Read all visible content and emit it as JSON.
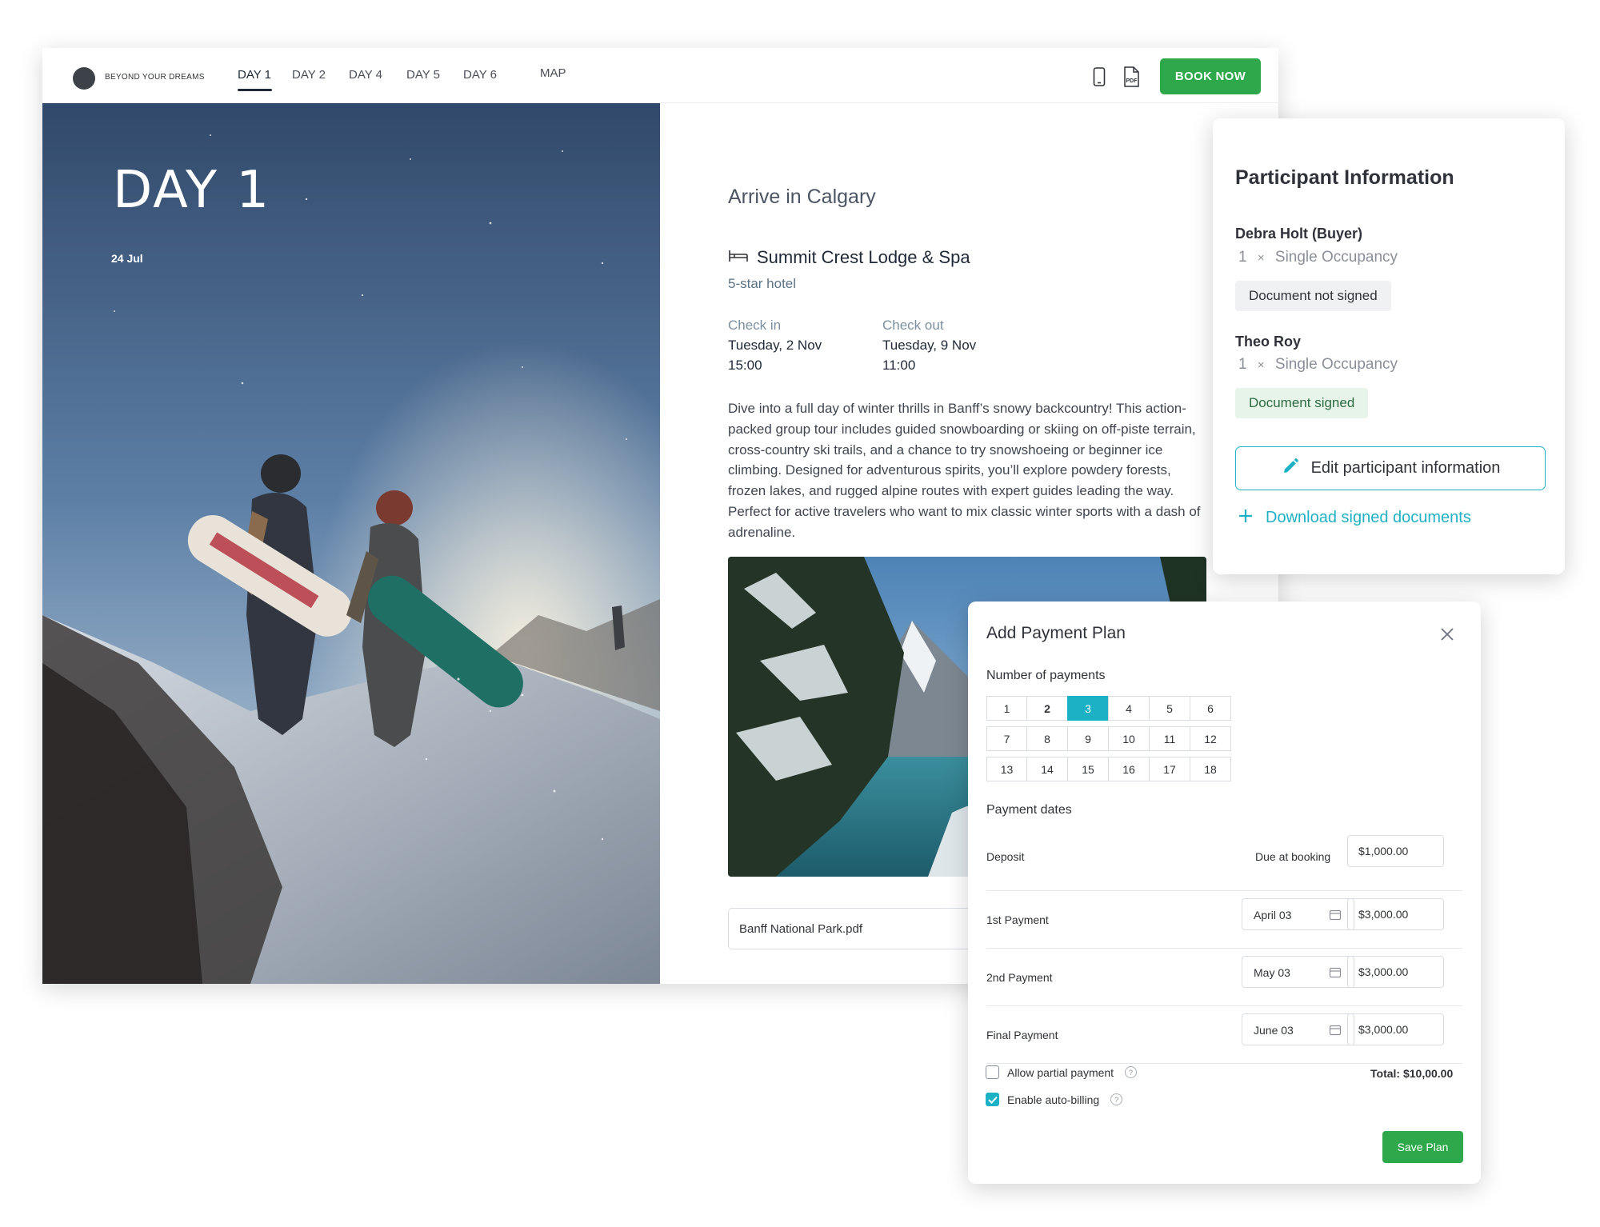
{
  "brand": {
    "name": "BEYOND YOUR DREAMS"
  },
  "nav": {
    "tabs": [
      {
        "label": "DAY 1",
        "active": true
      },
      {
        "label": "DAY 2"
      },
      {
        "label": "DAY 4"
      },
      {
        "label": "DAY 5"
      },
      {
        "label": "DAY 6"
      },
      {
        "label": "MAP"
      }
    ],
    "icons": [
      "mobile-icon",
      "pdf-icon"
    ],
    "pdf_icon_text": "PDF",
    "book_label": "BOOK NOW"
  },
  "hero": {
    "title": "DAY 1",
    "date": "24 Jul"
  },
  "day": {
    "heading": "Arrive in Calgary",
    "hotel_name": "Summit Crest Lodge & Spa",
    "hotel_type": "5-star hotel",
    "check_in_label": "Check in",
    "check_in_date": "Tuesday, 2 Nov",
    "check_in_time": "15:00",
    "check_out_label": "Check out",
    "check_out_date": "Tuesday, 9 Nov",
    "check_out_time": "11:00",
    "description": "Dive into a full day of winter thrills in Banff’s snowy backcountry! This action-packed group tour includes guided snowboarding or skiing on off-piste terrain, cross-country ski trails, and a chance to try snowshoeing or beginner ice climbing. Designed for adventurous spirits, you’ll explore powdery forests, frozen lakes, and rugged alpine routes with expert guides leading the way. Perfect for active travelers who want to mix classic winter sports with a dash of adrenaline.",
    "attachment": "Banff National Park.pdf"
  },
  "participants": {
    "title": "Participant Information",
    "people": [
      {
        "name": "Debra Holt (Buyer)",
        "qty": "1",
        "times": "×",
        "occupancy": "Single Occupancy",
        "status": "Document not signed"
      },
      {
        "name": "Theo Roy",
        "qty": "1",
        "times": "×",
        "occupancy": "Single Occupancy",
        "status": "Document signed"
      }
    ],
    "edit_label": "Edit participant information",
    "download_label": "Download signed documents"
  },
  "payment_plan": {
    "title": "Add Payment Plan",
    "number_label": "Number of payments",
    "numbers": [
      "1",
      "2",
      "3",
      "4",
      "5",
      "6",
      "7",
      "8",
      "9",
      "10",
      "11",
      "12",
      "13",
      "14",
      "15",
      "16",
      "17",
      "18"
    ],
    "selected_number": "3",
    "dates_label": "Payment dates",
    "deposit": {
      "name": "Deposit",
      "due": "Due at booking",
      "amount": "$1,000.00"
    },
    "payments": [
      {
        "name": "1st Payment",
        "date": "April 03",
        "amount": "$3,000.00"
      },
      {
        "name": "2nd Payment",
        "date": "May 03",
        "amount": "$3,000.00"
      },
      {
        "name": "Final Payment",
        "date": "June 03",
        "amount": "$3,000.00"
      }
    ],
    "allow_partial_label": "Allow partial payment",
    "allow_partial_checked": false,
    "auto_billing_label": "Enable auto-billing",
    "auto_billing_checked": true,
    "help_glyph": "?",
    "total": "Total: $10,00.00",
    "save_label": "Save Plan"
  },
  "colors": {
    "accent": "#1db1c5",
    "book_green": "#2ea84a",
    "signed_bg": "#e6f4ea",
    "unsigned_bg": "#f0f1f3"
  }
}
